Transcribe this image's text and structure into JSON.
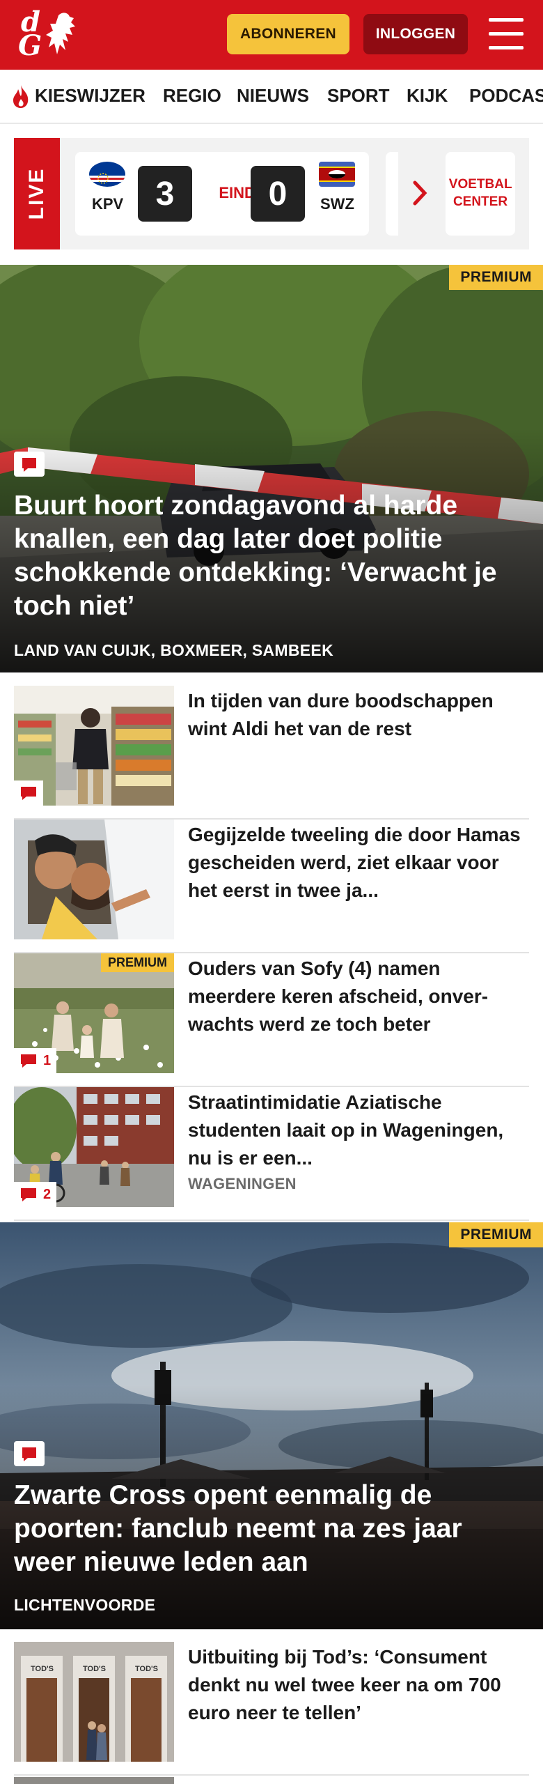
{
  "header": {
    "logo_text_d": "d",
    "logo_text_g": "G",
    "subscribe_label": "ABONNEREN",
    "login_label": "INLOGGEN",
    "colors": {
      "brand": "#d3141c",
      "accent": "#f5c33b"
    }
  },
  "nav": {
    "items": [
      {
        "label": "KIESWIJZER",
        "icon": "flame-icon"
      },
      {
        "label": "REGIO"
      },
      {
        "label": "NIEUWS"
      },
      {
        "label": "SPORT"
      },
      {
        "label": "KIJK"
      },
      {
        "label": "PODCAS"
      }
    ]
  },
  "live": {
    "tag": "LIVE",
    "match": {
      "home_code": "KPV",
      "home_score": "3",
      "status": "EINDE",
      "away_score": "0",
      "away_code": "SWZ"
    },
    "voetbal_center_label": "VOETBAL CENTER"
  },
  "articles": [
    {
      "title": "Buurt hoort zondagavond al harde knallen, een dag later doet politie schokkende ontdekking: ‘Verwacht je toch niet’",
      "location": "LAND VAN CUIJK, BOXMEER, SAMBEEK",
      "premium": "PREMIUM"
    },
    {
      "title": "In tijden van dure boodschappen wint Aldi het van de rest"
    },
    {
      "title": "Gegijzelde tweeling die door Hamas gescheiden werd, ziet elkaar voor het eerst in twee ja..."
    },
    {
      "title": "Ouders van Sofy (4) namen meerdere keren afscheid, onver­wachts werd ze toch beter",
      "premium": "PREMIUM",
      "comments": "1"
    },
    {
      "title": "Straatintimidatie Aziatische studenten laait op in Wageningen, nu is er een...",
      "location": "WAGENINGEN",
      "comments": "2"
    },
    {
      "title": "Zwarte Cross opent eenmalig de poorten: fanclub neemt na zes jaar weer nieuwe leden aan",
      "location": "LICHTENVOORDE",
      "premium": "PREMIUM"
    },
    {
      "title": "Uitbuiting bij Tod’s: ‘Consument denkt nu wel twee keer na om 700 euro neer te tellen’"
    }
  ]
}
